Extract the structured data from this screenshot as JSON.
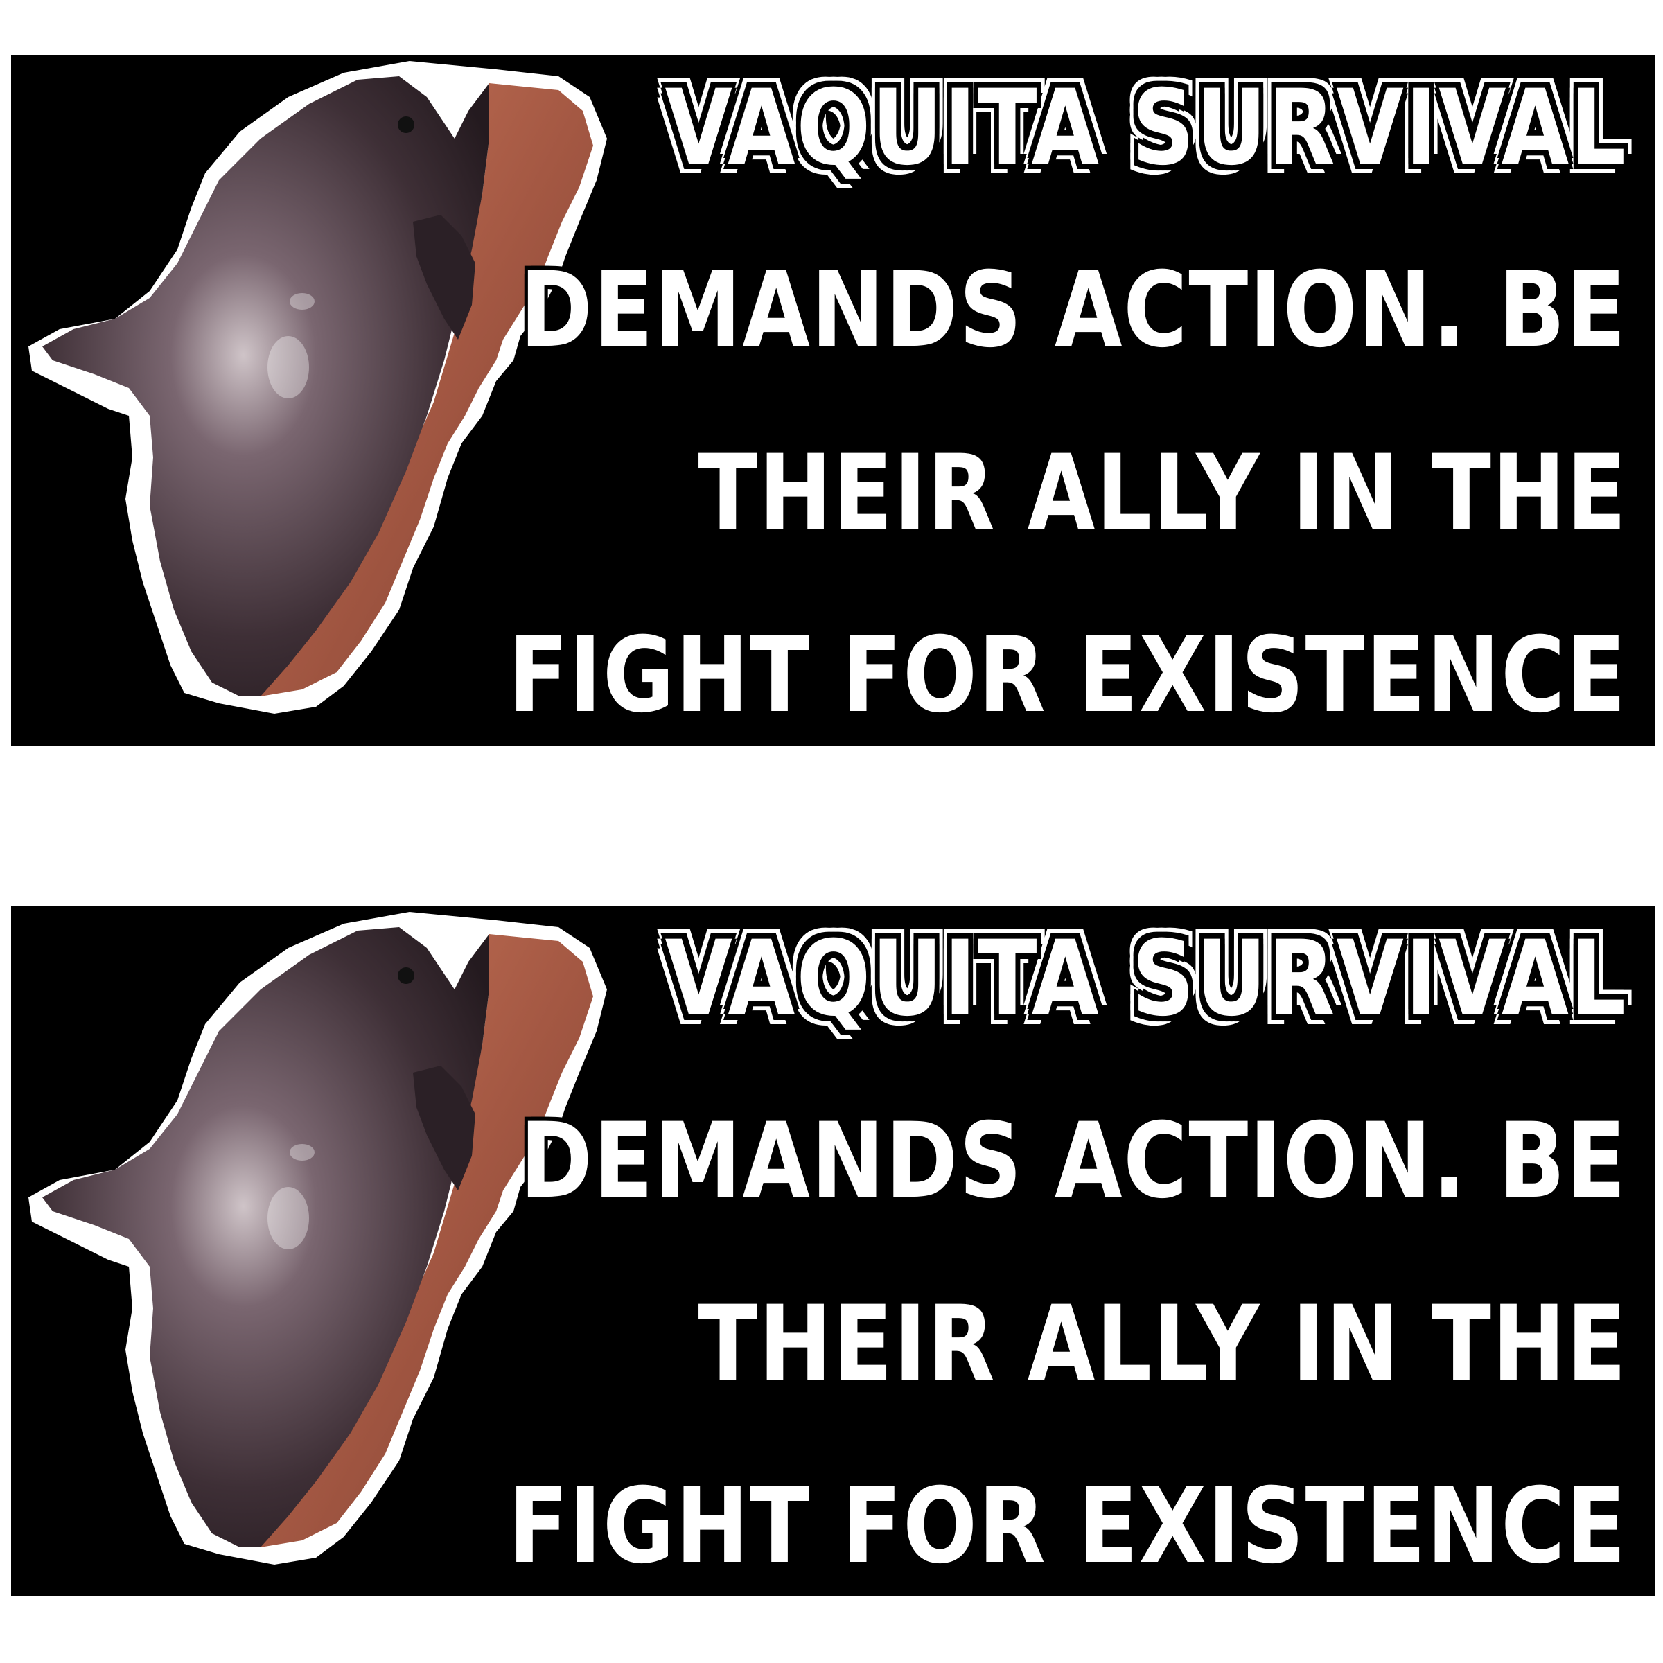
{
  "stickers": [
    {
      "lines": [
        "VAQUITA SURVIVAL",
        "DEMANDS ACTION. BE",
        "THEIR ALLY IN THE",
        "FIGHT FOR EXISTENCE"
      ]
    },
    {
      "lines": [
        "VAQUITA SURVIVAL",
        "DEMANDS ACTION. BE",
        "THEIR ALLY IN THE",
        "FIGHT FOR EXISTENCE"
      ]
    }
  ],
  "colors": {
    "background": "#ffffff",
    "sticker_fill": "#000000",
    "text": "#ffffff",
    "animal_body": "#4a3a40",
    "sand": "#b0614a"
  },
  "image": {
    "subject": "vaquita-porpoise-photo",
    "outline": "white"
  }
}
